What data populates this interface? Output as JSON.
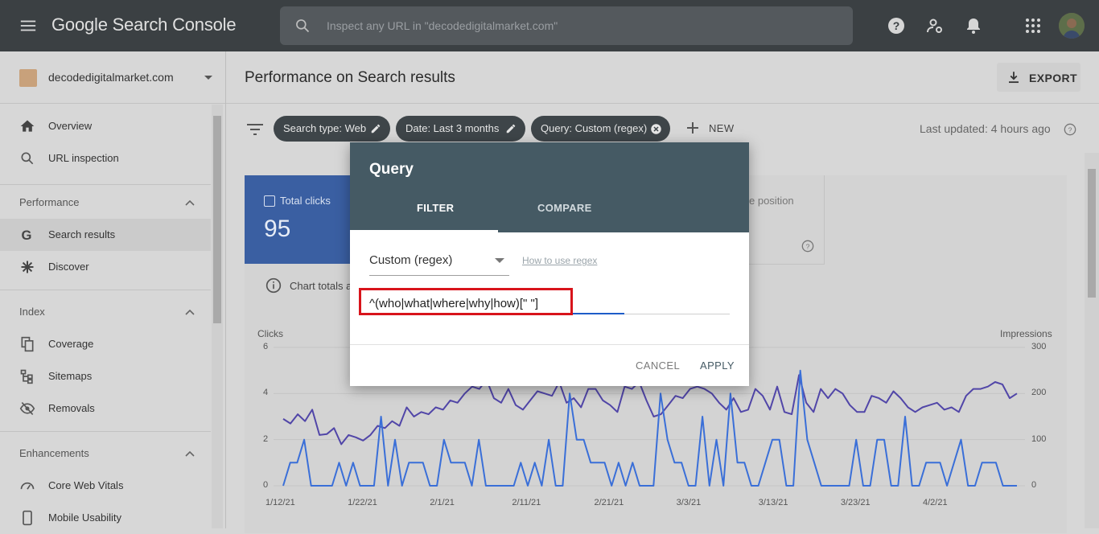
{
  "app": {
    "title": "Google Search Console",
    "search_placeholder": "Inspect any URL in \"decodedigitalmarket.com\""
  },
  "sidebar": {
    "property": "decodedigitalmarket.com",
    "items": [
      {
        "label": "Overview",
        "icon": "home-icon"
      },
      {
        "label": "URL inspection",
        "icon": "search-icon"
      }
    ],
    "sections": [
      {
        "title": "Performance",
        "items": [
          {
            "label": "Search results",
            "icon": "google-g-icon",
            "active": true
          },
          {
            "label": "Discover",
            "icon": "asterisk-icon"
          }
        ]
      },
      {
        "title": "Index",
        "items": [
          {
            "label": "Coverage",
            "icon": "copy-icon"
          },
          {
            "label": "Sitemaps",
            "icon": "sitemap-icon"
          },
          {
            "label": "Removals",
            "icon": "eye-off-icon"
          }
        ]
      },
      {
        "title": "Enhancements",
        "items": [
          {
            "label": "Core Web Vitals",
            "icon": "speedometer-icon"
          },
          {
            "label": "Mobile Usability",
            "icon": "phone-icon"
          }
        ]
      }
    ]
  },
  "main": {
    "title": "Performance on Search results",
    "export_label": "EXPORT",
    "filters": [
      "Search type: Web",
      "Date: Last 3 months",
      "Query: Custom (regex)"
    ],
    "new_label": "NEW",
    "last_updated": "Last updated: 4 hours ago",
    "metric_total_clicks": {
      "label": "Total clicks",
      "value": "95"
    },
    "metric_position_label": "e position",
    "chart_note": "Chart totals a"
  },
  "chart_data": {
    "type": "line",
    "x_labels": [
      "1/12/21",
      "1/22/21",
      "2/1/21",
      "2/11/21",
      "2/21/21",
      "3/3/21",
      "3/13/21",
      "3/23/21",
      "4/2/21"
    ],
    "left_axis": {
      "title": "Clicks",
      "ticks": [
        0,
        2,
        4,
        6
      ],
      "ylim": [
        0,
        6
      ]
    },
    "right_axis": {
      "title": "Impressions",
      "ticks": [
        0,
        100,
        200,
        300
      ],
      "ylim": [
        0,
        300
      ]
    },
    "series": [
      {
        "name": "Impressions",
        "axis": "right",
        "color": "#5146a8",
        "values": [
          145,
          135,
          155,
          140,
          165,
          110,
          112,
          125,
          90,
          110,
          105,
          98,
          110,
          130,
          125,
          140,
          130,
          170,
          150,
          160,
          155,
          170,
          165,
          185,
          180,
          200,
          215,
          210,
          230,
          190,
          180,
          210,
          175,
          165,
          185,
          205,
          200,
          195,
          225,
          180,
          190,
          170,
          210,
          210,
          185,
          175,
          160,
          215,
          210,
          225,
          185,
          150,
          155,
          175,
          195,
          190,
          210,
          215,
          210,
          200,
          180,
          165,
          190,
          160,
          165,
          210,
          195,
          165,
          215,
          160,
          155,
          240,
          180,
          160,
          210,
          190,
          210,
          200,
          175,
          160,
          160,
          195,
          190,
          180,
          205,
          190,
          170,
          160,
          170,
          175,
          180,
          165,
          170,
          160,
          195,
          210,
          210,
          215,
          225,
          220,
          190,
          200
        ]
      },
      {
        "name": "Clicks",
        "axis": "left",
        "color": "#3a6fd8",
        "values": [
          0,
          1,
          1,
          2,
          0,
          0,
          0,
          0,
          1,
          0,
          1,
          0,
          0,
          0,
          3,
          0,
          2,
          0,
          1,
          1,
          1,
          0,
          0,
          2,
          1,
          1,
          1,
          0,
          2,
          0,
          0,
          0,
          0,
          0,
          1,
          0,
          1,
          0,
          2,
          0,
          0,
          4,
          2,
          2,
          1,
          1,
          1,
          0,
          1,
          0,
          1,
          0,
          0,
          0,
          4,
          2,
          1,
          1,
          0,
          0,
          3,
          0,
          2,
          0,
          4,
          1,
          1,
          0,
          0,
          1,
          2,
          2,
          0,
          0,
          5,
          2,
          1,
          0,
          0,
          0,
          0,
          0,
          2,
          0,
          0,
          2,
          2,
          0,
          0,
          3,
          0,
          0,
          1,
          1,
          1,
          0,
          1,
          2,
          0,
          0,
          1,
          1,
          1,
          0,
          0,
          0
        ]
      }
    ]
  },
  "dialog": {
    "title": "Query",
    "tabs": [
      "FILTER",
      "COMPARE"
    ],
    "select_value": "Custom (regex)",
    "help_link": "How to use regex",
    "regex_value": "^(who|what|where|why|how)[\" \"]",
    "cancel": "CANCEL",
    "apply": "APPLY"
  },
  "colors": {
    "dialog_header": "#455a64",
    "highlight": "#d8141b",
    "active_metric": "#3a5fa2"
  }
}
